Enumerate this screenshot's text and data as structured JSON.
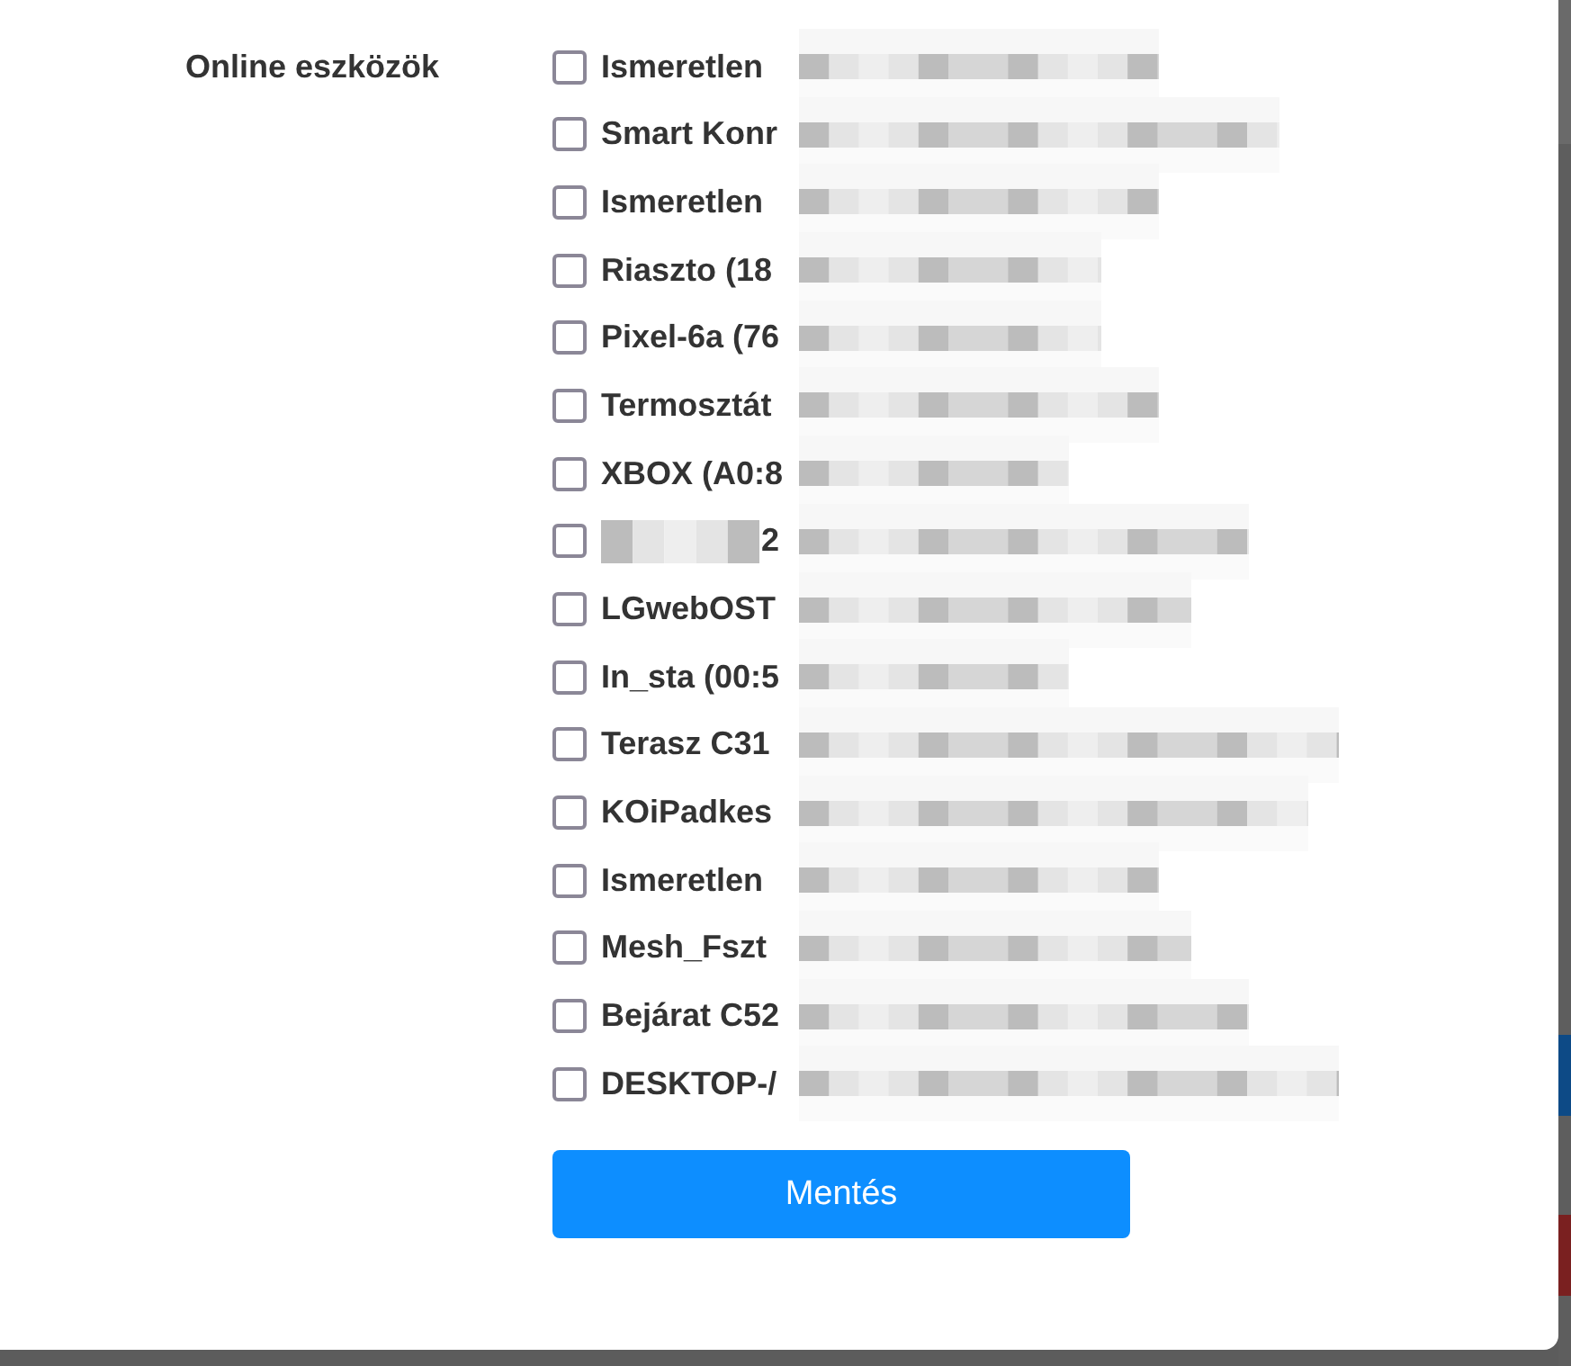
{
  "field_label": "Online eszközök",
  "devices": [
    {
      "label": "Ismeretlen",
      "checked": false
    },
    {
      "label": "Smart Konr",
      "checked": false
    },
    {
      "label": "Ismeretlen",
      "checked": false
    },
    {
      "label": "Riaszto (18",
      "checked": false
    },
    {
      "label": "Pixel-6a (76",
      "checked": false
    },
    {
      "label": "Termosztát",
      "checked": false
    },
    {
      "label": "XBOX (A0:8",
      "checked": false
    },
    {
      "label": "2",
      "checked": false,
      "kind": "masked"
    },
    {
      "label": "LGwebOST",
      "checked": false
    },
    {
      "label": "In_sta (00:5",
      "checked": false
    },
    {
      "label": "Terasz C31",
      "checked": false
    },
    {
      "label": "KOiPadkes",
      "checked": false
    },
    {
      "label": "Ismeretlen",
      "checked": false
    },
    {
      "label": "Mesh_Fszt",
      "checked": false
    },
    {
      "label": "Bejárat C52",
      "checked": false
    },
    {
      "label": "DESKTOP-/",
      "checked": false
    }
  ],
  "save_button": "Mentés"
}
